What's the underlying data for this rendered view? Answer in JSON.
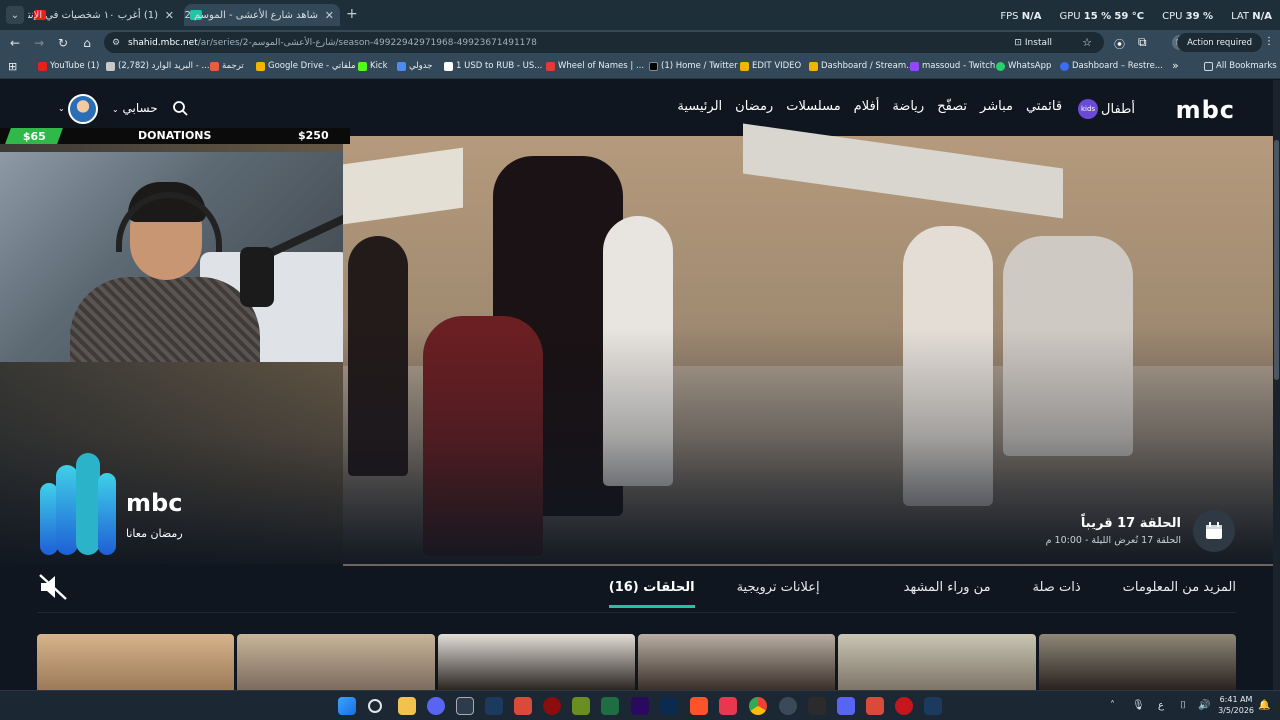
{
  "browser": {
    "tabs": [
      {
        "title": "(1) أغرب ١٠ شخصيات في الإنترنت",
        "active": false
      },
      {
        "title": "شاهد شارع الأعشى - الموسم 2 |",
        "active": true
      }
    ],
    "new_tab": "+",
    "hud": {
      "fps_label": "FPS",
      "fps_value": "N/A",
      "gpu_label": "GPU",
      "gpu_value": "15 %",
      "gpu_temp": "59 °C",
      "cpu_label": "CPU",
      "cpu_value": "39 %",
      "lat_label": "LAT",
      "lat_value": "N/A"
    },
    "url_host": "shahid.mbc.net",
    "url_path": "/ar/series/2-شارع-الأعشى-الموسم/season-49922942971968-49923671491178",
    "install_label": "Install",
    "profile_initial": "M",
    "action_required": "Action required",
    "bookmarks": [
      {
        "label": "YouTube (1)",
        "color": "#e62117"
      },
      {
        "label": "(2,782) البريد الوارد - ...",
        "color": "#c9c9c9"
      },
      {
        "label": "ترجمة",
        "color": "#e85d3a"
      },
      {
        "label": "Google Drive - ملفاتي",
        "color": "#f4b400"
      },
      {
        "label": "Kick",
        "color": "#53fc18"
      },
      {
        "label": "جدولي",
        "color": "#4b8bf5"
      },
      {
        "label": "1 USD to RUB - US...",
        "color": "#ffffff"
      },
      {
        "label": "Wheel of Names | ...",
        "color": "#e53935"
      },
      {
        "label": "(1) Home / Twitter",
        "color": "#000000"
      },
      {
        "label": "EDIT VIDEO",
        "color": "#f5b400"
      },
      {
        "label": "Dashboard / Stream...",
        "color": "#f5b400"
      },
      {
        "label": "massoud - Twitch",
        "color": "#9146ff"
      },
      {
        "label": "WhatsApp",
        "color": "#25d366"
      },
      {
        "label": "Dashboard – Restre...",
        "color": "#3d6df2"
      }
    ],
    "more_bookmarks": "»",
    "all_bookmarks": "All Bookmarks"
  },
  "site": {
    "logo": "mbc",
    "nav": [
      "الرئيسية",
      "رمضان",
      "مسلسلات",
      "أفلام",
      "رياضة",
      "تصفّح",
      "مباشر",
      "قائمتي",
      "أطفال"
    ],
    "kids_badge": "kids",
    "account_label": "حسابي",
    "hero": {
      "episode_title": "الحلقة 17 قريباً",
      "episode_sub": "الحلقة 17 تُعرض الليلة - 10:00 م",
      "ramadan_logo_text": "mbc",
      "ramadan_tagline": "رمضان معانا"
    },
    "section_tabs": [
      "الحلقات (16)",
      "إعلانات ترويجية",
      "من وراء المشهد",
      "ذات صلة",
      "المزيد من المعلومات"
    ],
    "thumb_colors": [
      "#c89d75",
      "#b9a58b",
      "#d4cfc8",
      "#a39a90",
      "#b7b39d",
      "#8a8376"
    ]
  },
  "overlay": {
    "donation_current": "$65",
    "donation_title": "DONATIONS",
    "donation_goal": "$250"
  },
  "taskbar": {
    "lang": "ع",
    "time": "6:41 AM",
    "date": "3/5/2026"
  }
}
